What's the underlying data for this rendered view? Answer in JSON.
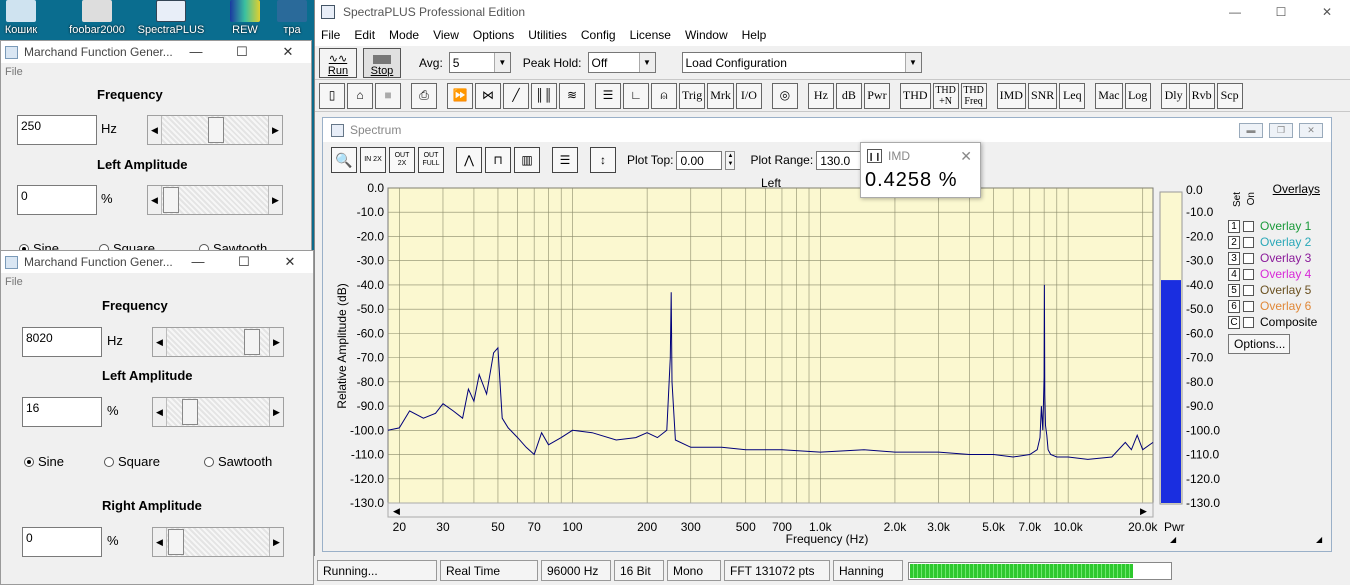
{
  "desktop": {
    "icons": [
      "Кошик",
      "foobar2000",
      "SpectraPLUS",
      "REW",
      "тра"
    ]
  },
  "gen1": {
    "title": "Marchand Function Gener...",
    "menu": "File",
    "freq_label": "Frequency",
    "freq_value": "250",
    "freq_unit": "Hz",
    "freq_slider": 0.5,
    "left_amp_label": "Left Amplitude",
    "left_amp_value": "0",
    "left_amp_unit": "%",
    "left_amp_slider": 0.0,
    "waves": [
      "Sine",
      "Square",
      "Sawtooth"
    ]
  },
  "gen2": {
    "title": "Marchand Function Gener...",
    "menu": "File",
    "freq_label": "Frequency",
    "freq_value": "8020",
    "freq_unit": "Hz",
    "freq_slider": 0.88,
    "left_amp_label": "Left Amplitude",
    "left_amp_value": "16",
    "left_amp_unit": "%",
    "left_amp_slider": 0.16,
    "waves": [
      "Sine",
      "Square",
      "Sawtooth"
    ],
    "wave_selected": "Sine",
    "right_amp_label": "Right Amplitude",
    "right_amp_value": "0",
    "right_amp_unit": "%",
    "right_amp_slider": 0.0
  },
  "app": {
    "title": "SpectraPLUS Professional Edition",
    "menu": [
      "File",
      "Edit",
      "Mode",
      "View",
      "Options",
      "Utilities",
      "Config",
      "License",
      "Window",
      "Help"
    ],
    "run_label": "Run",
    "stop_label": "Stop",
    "avg_label": "Avg:",
    "avg_value": "5",
    "peak_label": "Peak Hold:",
    "peak_value": "Off",
    "config_value": "Load Configuration",
    "toolbar2": [
      "Trig",
      "Mrk",
      "I/O",
      "Hz",
      "dB",
      "Pwr",
      "THD",
      "THD +N",
      "THD Freq",
      "IMD",
      "SNR",
      "Leq",
      "Mac",
      "Log",
      "Dly",
      "Rvb",
      "Scp"
    ]
  },
  "spectrum": {
    "title": "Spectrum",
    "plot_top_label": "Plot Top:",
    "plot_top_value": "0.00",
    "plot_range_label": "Plot Range:",
    "plot_range_value": "130.0",
    "zoom_buttons": [
      "IN 2X",
      "OUT 2X",
      "OUT FULL"
    ],
    "pwr_label": "Pwr",
    "overlays_title": "Overlays",
    "set_label": "Set",
    "on_label": "On",
    "overlays": [
      {
        "num": "1",
        "name": "Overlay 1",
        "color": "#1a9a3a"
      },
      {
        "num": "2",
        "name": "Overlay 2",
        "color": "#2aa8b8"
      },
      {
        "num": "3",
        "name": "Overlay 3",
        "color": "#8a1a9a"
      },
      {
        "num": "4",
        "name": "Overlay 4",
        "color": "#d82ad8"
      },
      {
        "num": "5",
        "name": "Overlay 5",
        "color": "#6a5020"
      },
      {
        "num": "6",
        "name": "Overlay 6",
        "color": "#e08838"
      },
      {
        "num": "C",
        "name": "Composite",
        "color": "#000000"
      }
    ],
    "options_button": "Options..."
  },
  "imd_popup": {
    "title": "IMD",
    "value": "0.4258 %"
  },
  "status": {
    "cells": [
      "Running...",
      "Real Time",
      "96000 Hz",
      "16 Bit",
      "Mono",
      "FFT 131072 pts",
      "Hanning"
    ],
    "level": 0.85
  },
  "chart_data": {
    "type": "line",
    "title": "Left",
    "xlabel": "Frequency (Hz)",
    "ylabel": "Relative Amplitude (dB)",
    "xscale": "log",
    "xlim": [
      18,
      22000
    ],
    "ylim": [
      -130,
      0
    ],
    "yticks": [
      0,
      -10,
      -20,
      -30,
      -40,
      -50,
      -60,
      -70,
      -80,
      -90,
      -100,
      -110,
      -120,
      -130
    ],
    "ytick_labels": [
      "0.0",
      "-10.0",
      "-20.0",
      "-30.0",
      "-40.0",
      "-50.0",
      "-60.0",
      "-70.0",
      "-80.0",
      "-90.0",
      "-100.0",
      "-110.0",
      "-120.0",
      "-130.0"
    ],
    "xticks": [
      20,
      30,
      50,
      70,
      100,
      200,
      300,
      500,
      700,
      1000,
      2000,
      3000,
      5000,
      7000,
      10000,
      20000
    ],
    "xtick_labels": [
      "20",
      "30",
      "50",
      "70",
      "100",
      "200",
      "300",
      "500",
      "700",
      "1.0k",
      "2.0k",
      "3.0k",
      "5.0k",
      "7.0k",
      "10.0k",
      "20.0k"
    ],
    "grid": true,
    "line_color": "#000080",
    "series": [
      {
        "name": "Left",
        "x": [
          18,
          20,
          22,
          25,
          28,
          30,
          33,
          36,
          38,
          40,
          42,
          45,
          48,
          50,
          52,
          55,
          60,
          65,
          70,
          75,
          80,
          90,
          100,
          120,
          150,
          180,
          200,
          220,
          240,
          248,
          250,
          252,
          260,
          300,
          400,
          500,
          700,
          1000,
          1500,
          2000,
          3000,
          4000,
          5000,
          6000,
          7000,
          7500,
          7700,
          7800,
          7900,
          8000,
          8020,
          8050,
          8100,
          8200,
          8300,
          8500,
          9000,
          10000,
          12000,
          15000,
          17000,
          18000,
          19000,
          20000,
          22000
        ],
        "y": [
          -100,
          -99,
          -92,
          -95,
          -93,
          -89,
          -92,
          -95,
          -83,
          -88,
          -77,
          -85,
          -68,
          -66,
          -95,
          -99,
          -103,
          -107,
          -110,
          -101,
          -106,
          -103,
          -100,
          -101,
          -104,
          -103,
          -101,
          -103,
          -100,
          -70,
          -43,
          -80,
          -104,
          -107,
          -107,
          -108,
          -108,
          -109,
          -108,
          -109,
          -109,
          -110,
          -110,
          -111,
          -110,
          -108,
          -103,
          -90,
          -100,
          -78,
          -40,
          -85,
          -98,
          -102,
          -108,
          -110,
          -111,
          -111,
          -112,
          -111,
          -105,
          -108,
          -102,
          -108,
          -105
        ]
      }
    ],
    "power_bar": {
      "label": "Pwr",
      "value_db": -38
    }
  }
}
